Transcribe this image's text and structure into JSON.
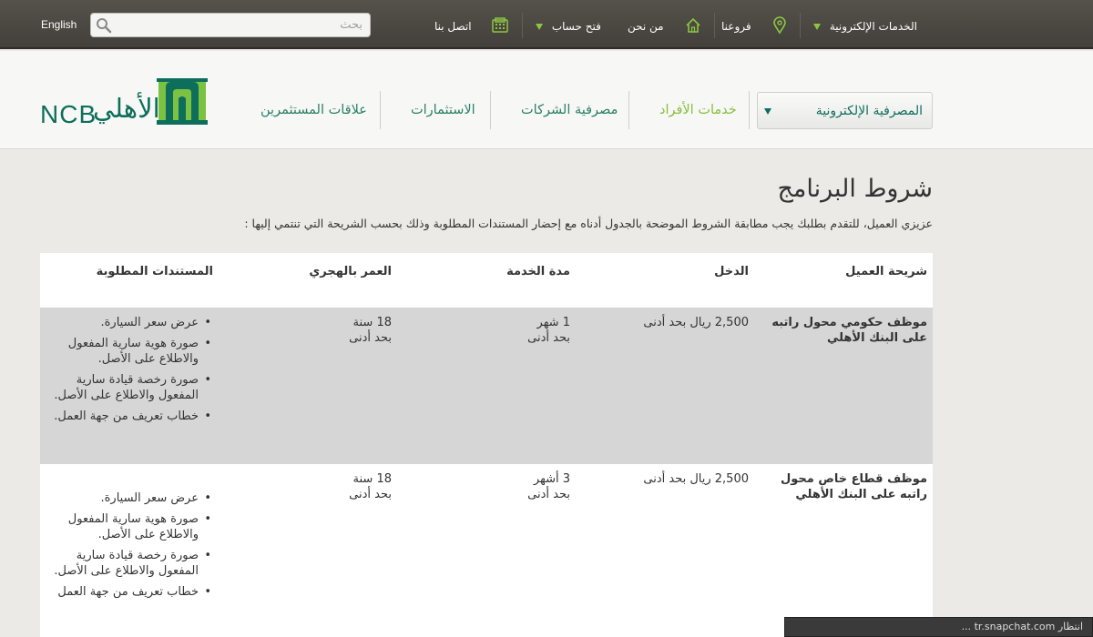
{
  "topbar": {
    "language": "English",
    "search_placeholder": "بحث",
    "eservices": "الخدمات الإلكترونية",
    "branches": "فروعنا",
    "about": "من نحن",
    "open_account": "فتح حساب",
    "contact": "اتصل بنا"
  },
  "logo": {
    "en": "NCB",
    "ar": "الأهلي",
    "brand_color": "#0d6e5c",
    "accent_color": "#86bf3c"
  },
  "mainnav": {
    "dropdown": "المصرفية الإلكترونية",
    "items": [
      "خدمات الأفراد",
      "مصرفية الشركات",
      "الاستثمارات",
      "علاقات المستثمرين"
    ]
  },
  "content": {
    "title": "شروط البرنامج",
    "intro": "عزيزي العميل، للتقدم بطلبك يجب مطابقة الشروط الموضحة بالجدول أدناه مع إحضار المستندات المطلوبة وذلك بحسب الشريحة التي تنتمي إليها :"
  },
  "table": {
    "headers": [
      "شريحة العميل",
      "الدخل",
      "مدة الخدمة",
      "العمر بالهجري",
      "المستندات المطلوبة"
    ],
    "rows": [
      {
        "segment_1": "موظف حكومي محول راتبه",
        "segment_2": "على البنك الأهلي",
        "income": "2,500 ريال بحد أدنى",
        "service_1": "1 شهر",
        "service_2": "بحد أدنى",
        "age_1": "18 سنة",
        "age_2": "بحد أدنى",
        "docs": [
          "عرض سعر السيارة.",
          "صورة هوية سارية المفعول والاطلاع على الأصل.",
          "صورة رخصة قيادة سارية المفعول والاطلاع على الأصل.",
          "خطاب تعريف من جهة العمل."
        ]
      },
      {
        "segment_1": "موظف قطاع خاص محول",
        "segment_2": "راتبه على البنك الأهلي",
        "income": "2,500 ريال بحد أدنى",
        "service_1": "3 أشهر",
        "service_2": "بحد أدنى",
        "age_1": "18 سنة",
        "age_2": "بحد أدنى",
        "docs": [
          "عرض سعر السيارة.",
          "صورة هوية سارية المفعول والاطلاع على الأصل.",
          "صورة رخصة قيادة سارية المفعول والاطلاع على الأصل.",
          "خطاب تعريف من جهة العمل"
        ]
      }
    ]
  },
  "statusbar": {
    "text": "انتظار tr.snapchat.com ..."
  }
}
